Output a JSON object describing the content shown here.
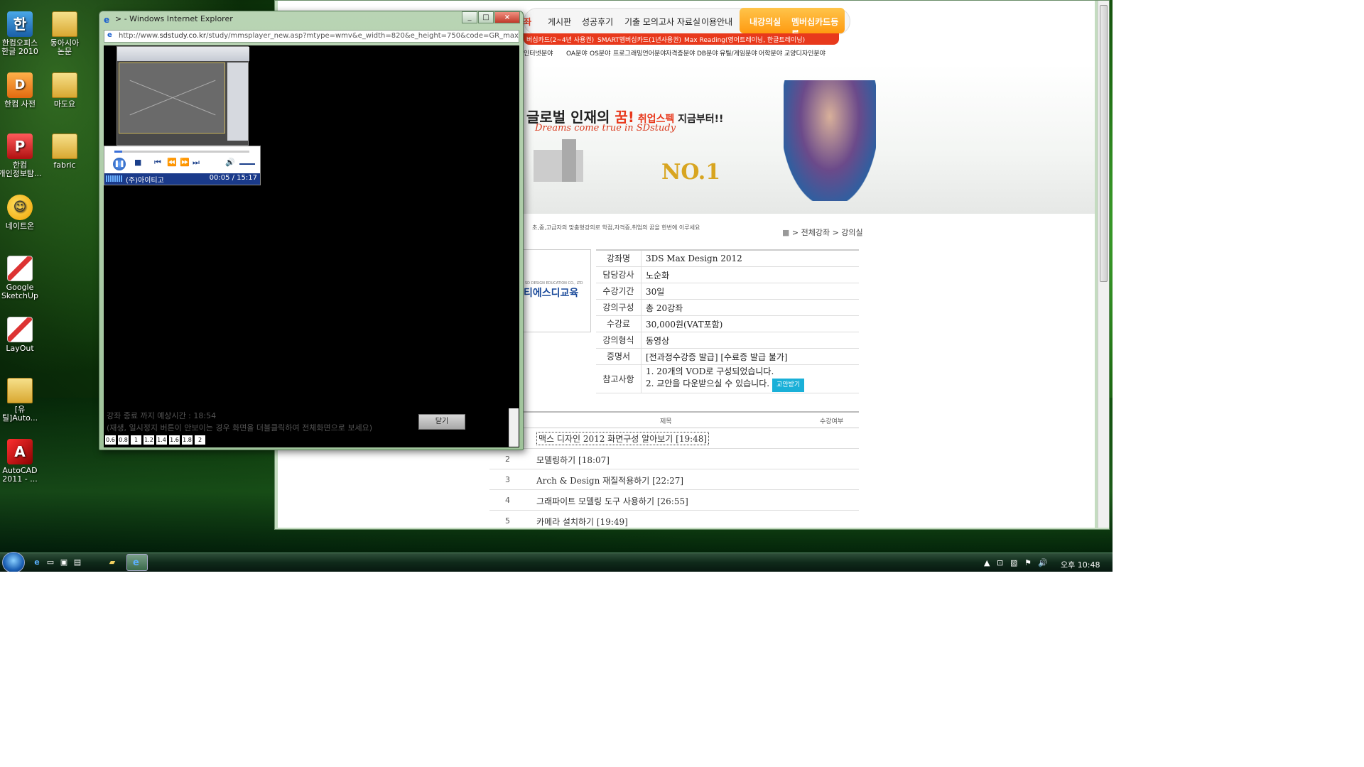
{
  "desktop": {
    "icons": [
      {
        "label": "한컴오피스\n한글 2010",
        "glyph": "한"
      },
      {
        "label": "동아시아\n논문",
        "glyph": ""
      },
      {
        "label": "한컴 사전",
        "glyph": "D"
      },
      {
        "label": "마도요",
        "glyph": ""
      },
      {
        "label": "한컴\n개인정보탐...",
        "glyph": "P"
      },
      {
        "label": "fabric",
        "glyph": ""
      },
      {
        "label": "네이트온",
        "glyph": "☺"
      },
      {
        "label": "Google\nSketchUp",
        "glyph": ""
      },
      {
        "label": "LayOut",
        "glyph": ""
      },
      {
        "label": "[유틸]Auto...",
        "glyph": ""
      },
      {
        "label": "AutoCAD\n2011 - ...",
        "glyph": "A"
      }
    ]
  },
  "popup": {
    "title": "> - Windows Internet Explorer",
    "url_prefix": "http://www.",
    "url_domain": "sdstudy.co.kr",
    "url_rest": "/study/mmsplayer_new.asp?mtype=wmv&e_width=820&e_height=750&code=GR_maxde12&idx=1",
    "player": {
      "label": "(주)아이티고",
      "time": "00:05 / 15:17",
      "progress_fraction": 0.06
    },
    "remaining_time": "강좌 종료 까지 예상시간 : 18:54",
    "note": "(재생, 일시정지 버튼이 안보이는 경우 화면을 더블클릭하여 전체화면으로 보세요)",
    "close_label": "닫기",
    "speeds": [
      "0.6",
      "0.8",
      "1",
      "1.2",
      "1.4",
      "1.6",
      "1.8",
      "2"
    ]
  },
  "site": {
    "nav_fragment": "좌",
    "nav": [
      "게시판",
      "성공후기",
      "기출 모의고사 자료실",
      "이용안내"
    ],
    "orange": [
      "내강의실",
      "멤버십카드등록"
    ],
    "red_bar": [
      "버십카드(2~4년 사용권)",
      "SMART멤버십카드(1년사용권)",
      "Max Reading(영어트레이닝, 한글트레이닝)"
    ],
    "categories": [
      "인터넷분야",
      "OA분야",
      "OS분야",
      "프로그래밍언어분야",
      "자격증분야",
      "DB분야",
      "유틸/게임분야",
      "어학분야",
      "교양디자인분야"
    ],
    "banner_line1_a": "글로벌 인재의 ",
    "banner_line1_b": "꿈!",
    "banner_line1_c": " 취업스펙",
    "banner_line1_d": " 지금부터!!",
    "banner_line2": "Dreams come true in SDstudy",
    "banner_no1": "NO.1",
    "sub_text": "초,중,고급자의 맞춤형강의로 학점,자격증,취업의 꿈을 한번에 이루세요",
    "breadcrumb": "> 전체강좌 > 강의실",
    "logo_small": "SD DESIGN EDUCATION CO., LTD",
    "logo": "티에스디교육",
    "info": [
      {
        "k": "강좌명",
        "v": "3DS Max Design 2012"
      },
      {
        "k": "담당강사",
        "v": "노순화"
      },
      {
        "k": "수강기간",
        "v": "30일"
      },
      {
        "k": "강의구성",
        "v": "총 20강좌"
      },
      {
        "k": "수강료",
        "v": "30,000원(VAT포함)"
      },
      {
        "k": "강의형식",
        "v": "동영상"
      },
      {
        "k": "증명서",
        "v": "[전과정수강증 발급] [수료증 발급 불가]"
      }
    ],
    "notes_key": "참고사항",
    "notes": [
      "1. 20개의 VOD로 구성되었습니다.",
      "2. 교안을 다운받으실 수 있습니다."
    ],
    "download_label": "교안받기",
    "lecture_head": {
      "title": "제목",
      "status": "수강여부"
    },
    "lectures": [
      {
        "n": "",
        "t": "맥스 디자인 2012 화면구성 알아보기   [19:48]"
      },
      {
        "n": "2",
        "t": "모델링하기  [18:07]"
      },
      {
        "n": "3",
        "t": "Arch & Design 재질적용하기  [22:27]"
      },
      {
        "n": "4",
        "t": "그래파이트 모델링 도구 사용하기  [26:55]"
      },
      {
        "n": "5",
        "t": "카메라 설치하기  [19:49]"
      }
    ]
  },
  "taskbar": {
    "clock": "오후 10:48"
  }
}
